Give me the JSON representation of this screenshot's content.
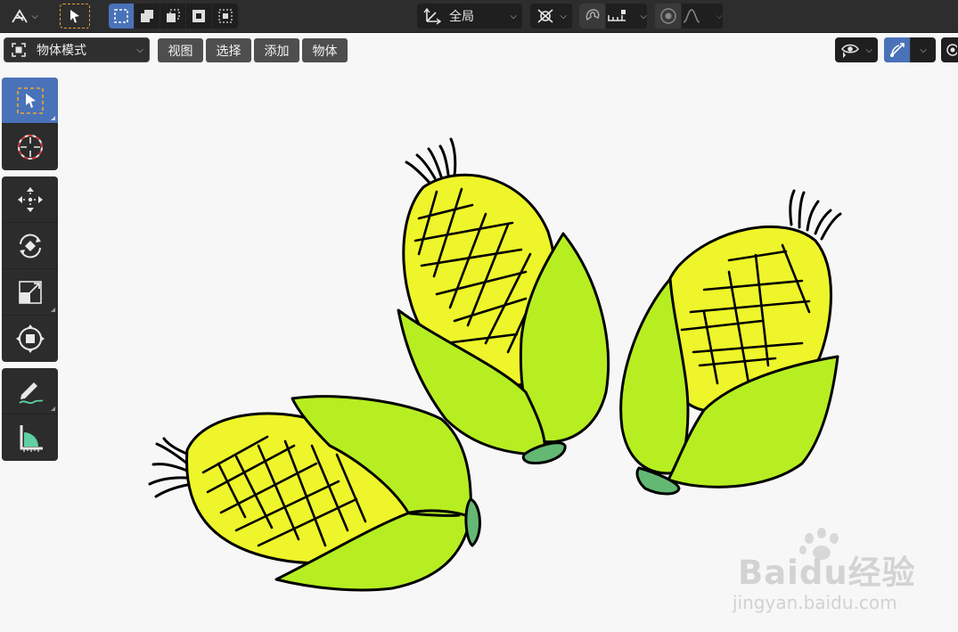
{
  "header": {
    "transform_orientation": "全局"
  },
  "mode": {
    "current": "物体模式"
  },
  "menus": [
    "视图",
    "选择",
    "添加",
    "物体"
  ],
  "toolbar": {
    "tools": [
      "select-box-icon",
      "cursor-icon",
      "move-icon",
      "rotate-icon",
      "scale-icon",
      "transform-icon",
      "annotate-icon",
      "measure-icon"
    ]
  },
  "watermark": {
    "brand": "Baidu经验",
    "url": "jingyan.baidu.com"
  },
  "colors": {
    "header_bg": "#2d2d2d",
    "active_blue": "#4a72b8",
    "canvas_bg": "#f7f7f7",
    "corn_yellow": "#eef52a",
    "husk_green": "#b6ee22",
    "stem_green": "#63b874"
  }
}
